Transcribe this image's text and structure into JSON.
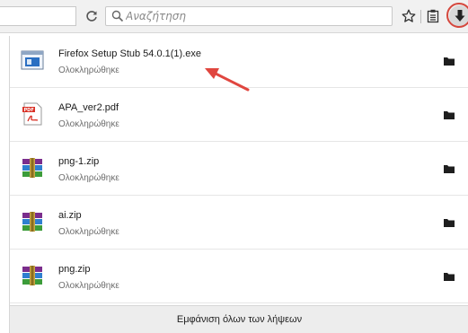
{
  "toolbar": {
    "search_placeholder": "Αναζήτηση",
    "icons": {
      "reload": "reload-icon",
      "search": "search-icon",
      "bookmark": "star-icon",
      "reading_list": "reading-list-icon",
      "downloads": "download-arrow-icon"
    }
  },
  "downloads": {
    "items": [
      {
        "name": "Firefox Setup Stub 54.0.1(1).exe",
        "status": "Ολοκληρώθηκε",
        "icon": "installer-icon"
      },
      {
        "name": "APA_ver2.pdf",
        "status": "Ολοκληρώθηκε",
        "icon": "pdf-icon"
      },
      {
        "name": "png-1.zip",
        "status": "Ολοκληρώθηκε",
        "icon": "archive-icon"
      },
      {
        "name": "ai.zip",
        "status": "Ολοκληρώθηκε",
        "icon": "archive-icon"
      },
      {
        "name": "png.zip",
        "status": "Ολοκληρώθηκε",
        "icon": "archive-icon"
      }
    ],
    "show_all_label": "Εμφάνιση όλων των λήψεων"
  },
  "colors": {
    "highlight_ring": "#d5473d",
    "annotation_arrow": "#e0463f",
    "panel_footer": "#ededed"
  }
}
